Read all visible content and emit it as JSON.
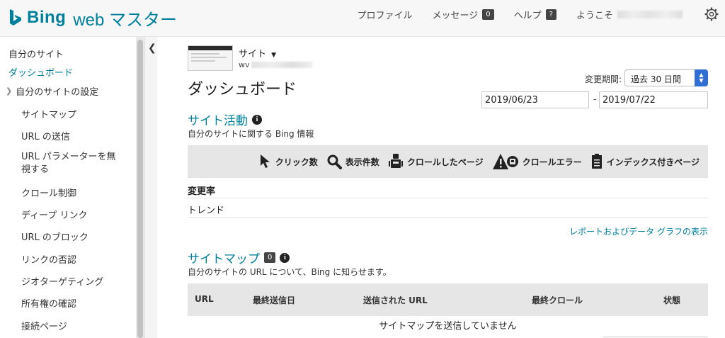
{
  "header": {
    "brand": "Bing",
    "product": "web マスター",
    "nav": [
      {
        "label": "プロファイル"
      },
      {
        "label": "メッセージ",
        "badge": "0"
      },
      {
        "label": "ヘルプ",
        "badge": "?"
      }
    ],
    "welcome": "ようこそ"
  },
  "sidebar": {
    "items": [
      {
        "label": "自分のサイト"
      },
      {
        "label": "ダッシュボード"
      },
      {
        "label": "自分のサイトの設定"
      },
      {
        "label": "サイトマップ"
      },
      {
        "label": "URL の送信"
      },
      {
        "label": "URL パラメーターを無"
      },
      {
        "label": "視する"
      },
      {
        "label": "クロール制御"
      },
      {
        "label": "ディープ リンク"
      },
      {
        "label": "URL のブロック"
      },
      {
        "label": "リンクの否認"
      },
      {
        "label": "ジオターゲティング"
      },
      {
        "label": "所有権の確認"
      },
      {
        "label": "接続ページ"
      }
    ]
  },
  "site": {
    "label": "サイト",
    "url_prefix": "wv"
  },
  "page_title": "ダッシュボード",
  "period": {
    "label": "変更期間:",
    "selected": "過去 30 日間",
    "start_date": "2019/06/23",
    "separator": "-",
    "end_date": "2019/07/22"
  },
  "site_activity": {
    "title": "サイト活動",
    "info": "i",
    "description": "自分のサイトに関する Bing 情報",
    "metrics": [
      {
        "label": "クリック数",
        "icon": "cursor-icon"
      },
      {
        "label": "表示件数",
        "icon": "magnifier-icon"
      },
      {
        "label": "クロールしたページ",
        "icon": "robot-icon"
      },
      {
        "label": "クロールエラー",
        "icon": "warning-robot-icon"
      },
      {
        "label": "インデックス付きページ",
        "icon": "document-icon"
      }
    ],
    "rows": [
      "変更率",
      "トレンド"
    ],
    "report_link": "レポートおよびデータ グラフの表示"
  },
  "sitemaps": {
    "title": "サイトマップ",
    "count": "0",
    "info": "i",
    "description": "自分のサイトの URL について、Bing に知らせます。",
    "columns": [
      "URL",
      "最終送信日",
      "送信された URL",
      "最終クロール",
      "状態"
    ],
    "empty_message": "サイトマップを送信していません"
  },
  "colors": {
    "accent": "#00809d",
    "header_bg": "#f7f7f7",
    "table_bg": "#e6e6e6",
    "select_arrow": "#2f6fd4"
  }
}
